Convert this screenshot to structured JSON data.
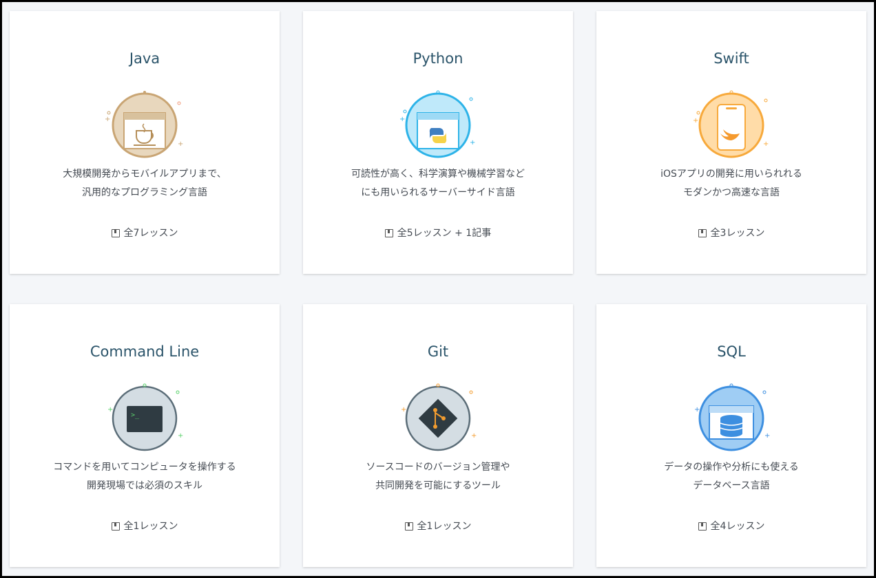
{
  "courses": [
    {
      "title": "Java",
      "desc_line1": "大規模開発からモバイルアプリまで、",
      "desc_line2": "汎用的なプログラミング言語",
      "lessons": "全7レッスン",
      "icon": "coffee-cup-icon",
      "color": "#c9a574"
    },
    {
      "title": "Python",
      "desc_line1": "可読性が高く、科学演算や機械学習など",
      "desc_line2": "にも用いられるサーバーサイド言語",
      "lessons": "全5レッスン + 1記事",
      "icon": "python-logo-icon",
      "color": "#2db3e8"
    },
    {
      "title": "Swift",
      "desc_line1": "iOSアプリの開発に用いられれる",
      "desc_line2": "モダンかつ高速な言語",
      "lessons": "全3レッスン",
      "icon": "swift-bird-icon",
      "color": "#f7a93b"
    },
    {
      "title": "Command Line",
      "desc_line1": "コマンドを用いてコンピュータを操作する",
      "desc_line2": "開発現場では必須のスキル",
      "lessons": "全1レッスン",
      "icon": "terminal-icon",
      "color": "#3a4a52"
    },
    {
      "title": "Git",
      "desc_line1": "ソースコードのバージョン管理や",
      "desc_line2": "共同開発を可能にするツール",
      "lessons": "全1レッスン",
      "icon": "git-logo-icon",
      "color": "#f39c2f"
    },
    {
      "title": "SQL",
      "desc_line1": "データの操作や分析にも使える",
      "desc_line2": "データベース言語",
      "lessons": "全4レッスン",
      "icon": "database-icon",
      "color": "#3d8fe0"
    }
  ]
}
